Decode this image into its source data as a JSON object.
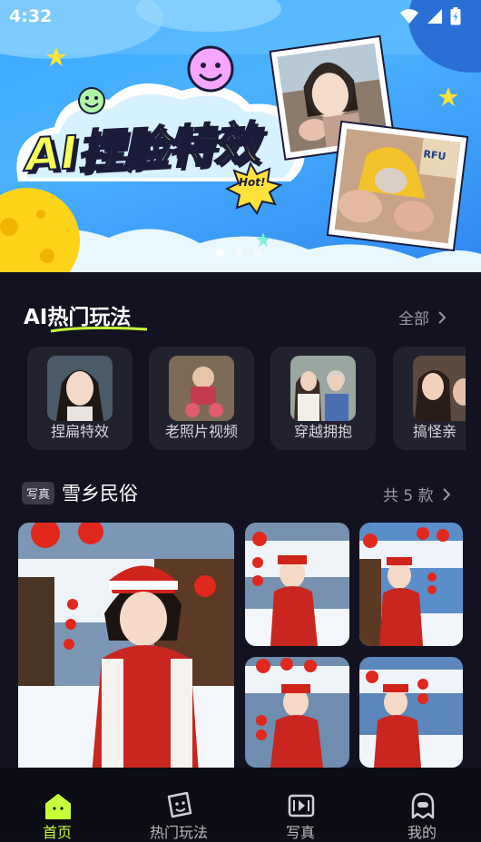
{
  "status_bar": {
    "time": "4:32"
  },
  "banner": {
    "title": "AI捏脸特效",
    "badge": "Hot!",
    "dots": 3,
    "active_dot": 0,
    "sticker_text": "RFU"
  },
  "hot_section": {
    "title": "AI热门玩法",
    "more_label": "全部",
    "items": [
      {
        "label": "捏扁特效"
      },
      {
        "label": "老照片视频"
      },
      {
        "label": "穿越拥抱"
      },
      {
        "label": "搞怪亲"
      }
    ]
  },
  "photo_section": {
    "tag": "写真",
    "title": "雪乡民俗",
    "count_label": "共 5 款"
  },
  "tab_bar": {
    "active": 0,
    "active_color": "#c6ff3a",
    "tabs": [
      {
        "label": "首页",
        "icon": "home-icon"
      },
      {
        "label": "热门玩法",
        "icon": "sticker-face-icon"
      },
      {
        "label": "写真",
        "icon": "photo-frame-icon"
      },
      {
        "label": "我的",
        "icon": "ghost-profile-icon"
      }
    ]
  }
}
